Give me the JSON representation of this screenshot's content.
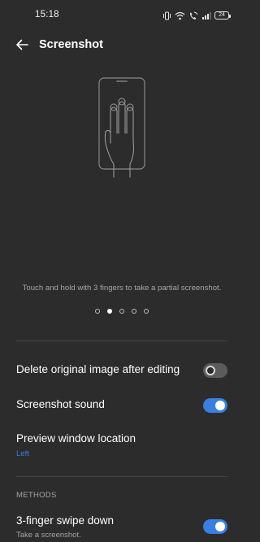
{
  "status_bar": {
    "time": "15:18",
    "battery": "24"
  },
  "header": {
    "title": "Screenshot"
  },
  "hint": {
    "caption": "Touch and hold with 3 fingers to take a partial screenshot."
  },
  "pager": {
    "total": 5,
    "active_index": 1
  },
  "settings": {
    "delete_original": {
      "label": "Delete original image after editing",
      "enabled": false
    },
    "screenshot_sound": {
      "label": "Screenshot sound",
      "enabled": true
    },
    "preview_location": {
      "label": "Preview window location",
      "value": "Left"
    }
  },
  "methods": {
    "header": "METHODS",
    "three_finger_swipe": {
      "label": "3-finger swipe down",
      "description": "Take a screenshot.",
      "enabled": true
    }
  },
  "colors": {
    "background": "#2c2c2c",
    "accent": "#3a7ee0",
    "secondary_text": "#a6a6a6"
  },
  "icons": [
    "back-arrow-icon",
    "vibrate-icon",
    "wifi-icon",
    "wifi-calling-icon",
    "signal-icon",
    "battery-icon",
    "three-finger-hand-icon"
  ]
}
